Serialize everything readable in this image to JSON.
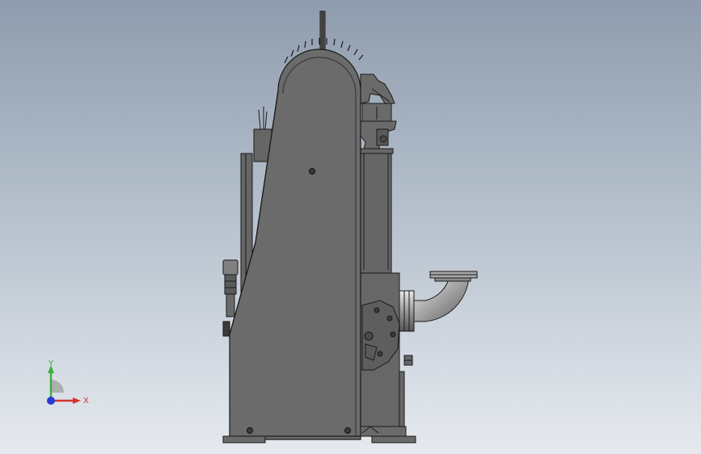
{
  "viewport": {
    "background_top": "#8f9cae",
    "background_bottom": "#e6eaef"
  },
  "triad": {
    "x_label": "X",
    "y_label": "Y",
    "x_color": "#d6342c",
    "y_color": "#3fae3f",
    "z_color": "#2d3ad0"
  },
  "model": {
    "body_color": "#6a6a6a",
    "edge_color": "#1a1a1a",
    "pipe_color": "#b8b8b8"
  }
}
